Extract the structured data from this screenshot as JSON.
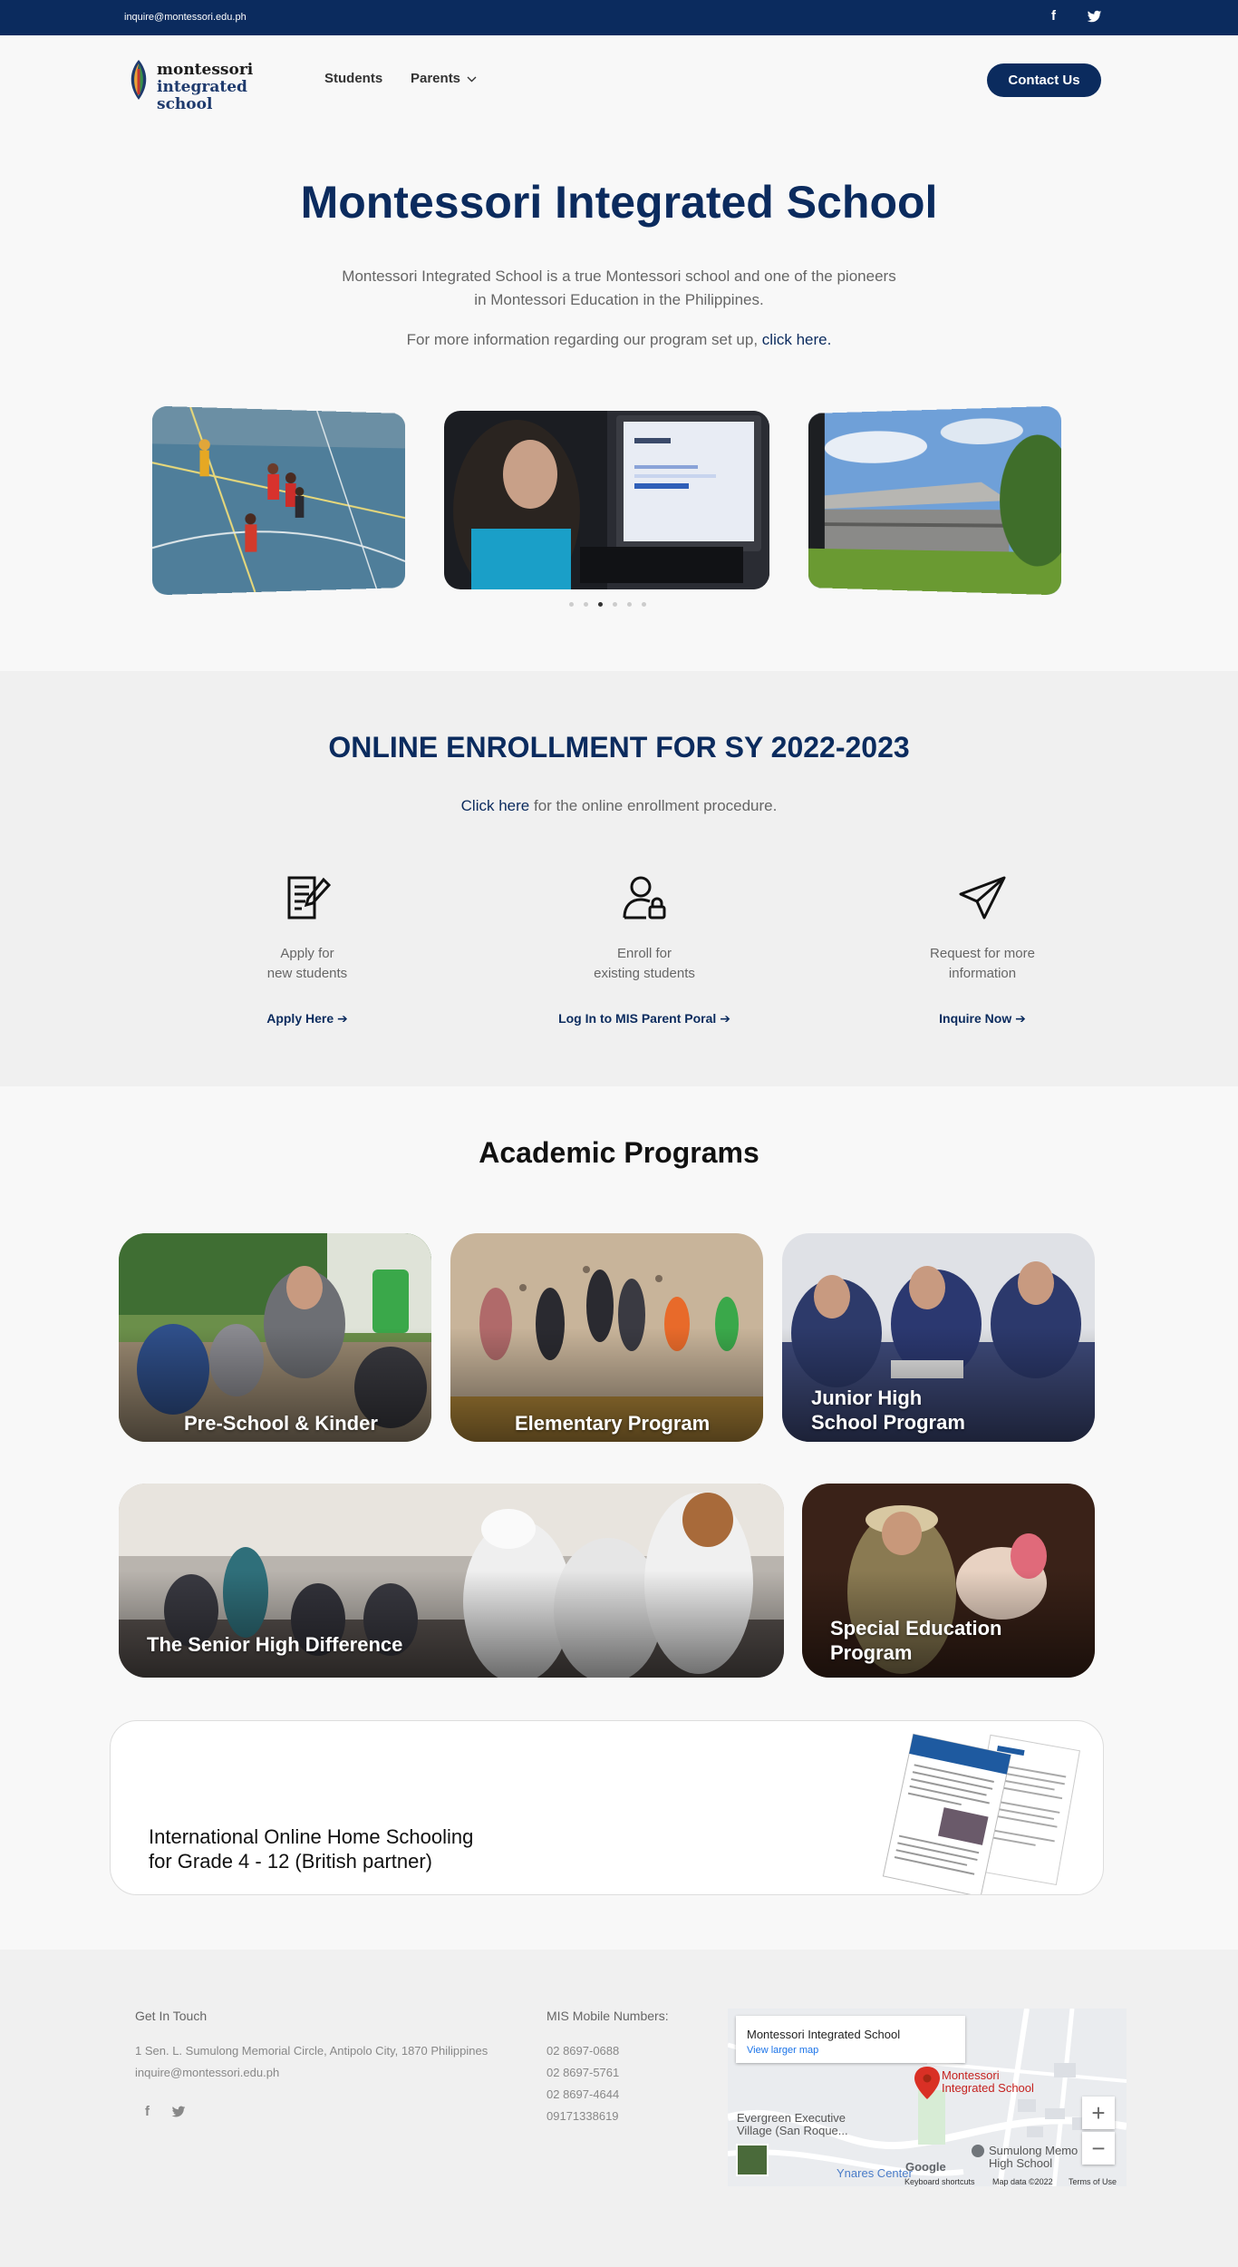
{
  "topbar": {
    "email": "inquire@montessori.edu.ph",
    "social": [
      {
        "icon": "facebook-icon",
        "glyph": "f"
      },
      {
        "icon": "twitter-icon",
        "glyph": "🐦"
      }
    ]
  },
  "nav": {
    "logo_line1": "montessori",
    "logo_line2": "integrated school",
    "students": "Students",
    "parents": "Parents",
    "contact": "Contact Us"
  },
  "hero": {
    "title": "Montessori Integrated School",
    "description": "Montessori Integrated School is a true Montessori school and one of the pioneers in Montessori Education in the Philippines.",
    "more_prefix": "For more information regarding our program set up,",
    "more_link": "click here."
  },
  "carousel": {
    "dot_count": 6,
    "active_dot": 2
  },
  "enrollment": {
    "title": "ONLINE ENROLLMENT FOR SY 2022-2023",
    "sub_link": "Click here",
    "sub_rest": "for the online enrollment procedure.",
    "steps": [
      {
        "icon": "document-pen-icon",
        "line1": "Apply for",
        "line2": "new students",
        "action": "Apply Here"
      },
      {
        "icon": "user-lock-icon",
        "line1": "Enroll for",
        "line2": "existing students",
        "action": "Log In to MIS Parent Poral"
      },
      {
        "icon": "paper-plane-icon",
        "line1": "Request for more",
        "line2": "information",
        "action": "Inquire Now"
      }
    ]
  },
  "programs": {
    "title": "Academic Programs",
    "cards": [
      {
        "line1": "Pre-School & Kinder",
        "line2": ""
      },
      {
        "line1": "Elementary Program",
        "line2": ""
      },
      {
        "line1": "Junior High",
        "line2": "School Program"
      },
      {
        "line1": "The Senior High Difference",
        "line2": ""
      },
      {
        "line1": "Special Education",
        "line2": "Program"
      }
    ],
    "homeschool_line1": "International Online Home Schooling",
    "homeschool_line2": "for Grade 4 - 12 (British partner)"
  },
  "footer": {
    "get_in_touch": "Get In Touch",
    "address": "1 Sen. L. Sumulong Memorial Circle, Antipolo City, 1870 Philippines",
    "email": "inquire@montessori.edu.ph",
    "mobile_title": "MIS Mobile Numbers:",
    "numbers": [
      "02 8697-0688",
      "02 8697-5761",
      "02 8697-4644",
      "09171338619"
    ],
    "map": {
      "place": "Montessori Integrated School",
      "view_larger": "View larger map",
      "pin_label_1": "Montessori",
      "pin_label_2": "Integrated School",
      "label_sumulong": "Sumulong Memo",
      "label_sumulong2": "High School",
      "label_evergreen": "Evergreen Executive",
      "label_evergreen2": "Village (San Roque...",
      "label_ynares": "Ynares Center",
      "keyboard": "Keyboard shortcuts",
      "mapdata": "Map data ©2022",
      "terms": "Terms of Use",
      "google": "Google"
    }
  }
}
